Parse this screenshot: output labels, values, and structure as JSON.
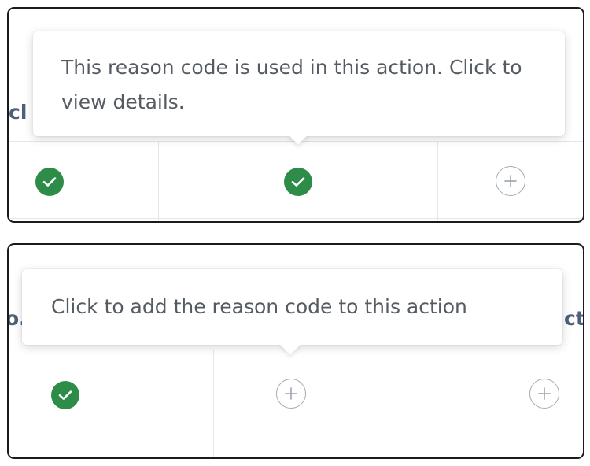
{
  "panels": [
    {
      "tooltip_text": "This reason code is used in this action. Click to view details.",
      "header_fragments": [
        "cl"
      ],
      "cells": [
        {
          "state": "used",
          "icon": "check-circle-icon"
        },
        {
          "state": "used",
          "icon": "check-circle-icon"
        },
        {
          "state": "available",
          "icon": "plus-circle-icon"
        }
      ]
    },
    {
      "tooltip_text": "Click to add the reason code to this action",
      "header_fragments": [
        "o.",
        "ct"
      ],
      "cells": [
        {
          "state": "used",
          "icon": "check-circle-icon"
        },
        {
          "state": "available",
          "icon": "plus-circle-icon"
        },
        {
          "state": "available",
          "icon": "plus-circle-icon"
        }
      ]
    }
  ],
  "colors": {
    "check_green": "#2d8c47",
    "plus_gray": "#a4abb4",
    "header_text": "#4d6079",
    "tooltip_text": "#555b62",
    "grid_line": "#e3e6ea",
    "panel_border": "#1b1b1b"
  }
}
